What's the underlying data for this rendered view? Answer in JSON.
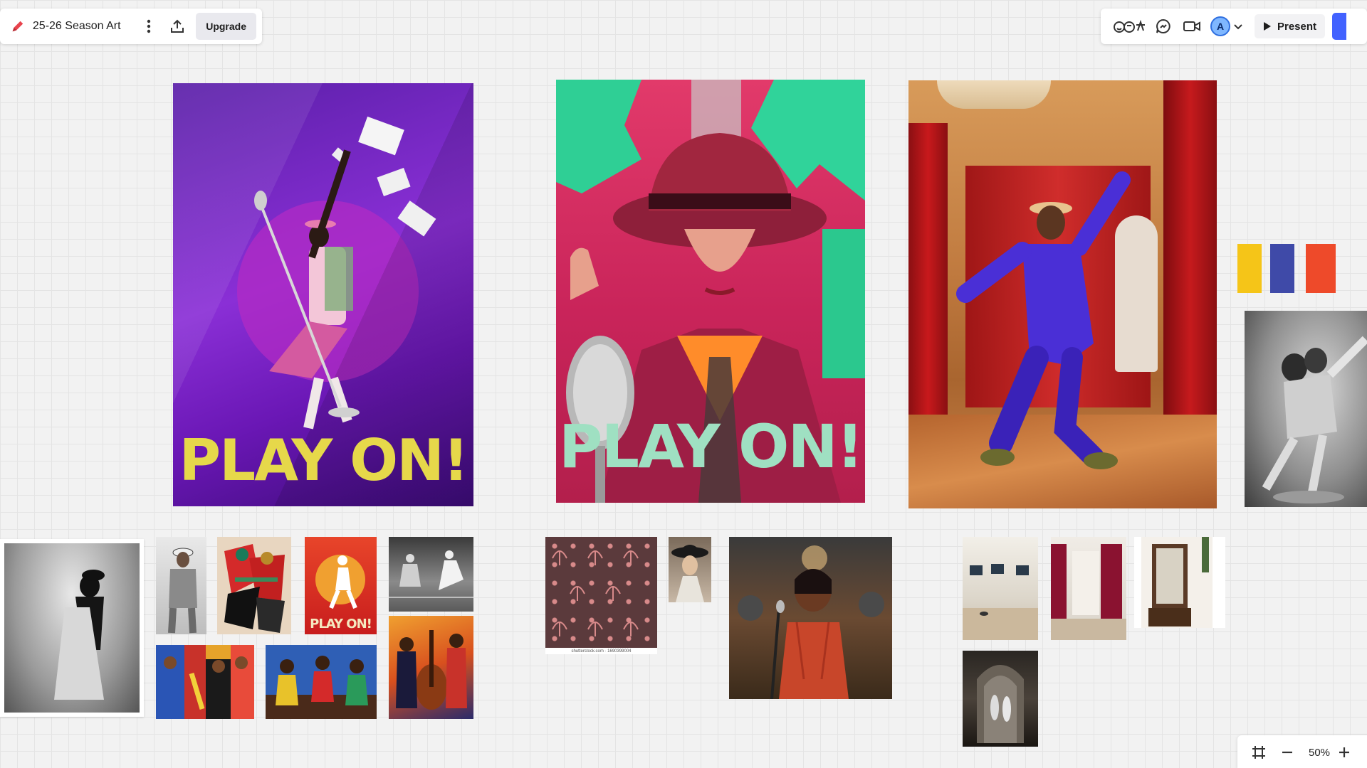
{
  "toolbar": {
    "board_title": "25-26 Season Art",
    "upgrade_label": "Upgrade",
    "present_label": "Present",
    "avatar_initial": "A",
    "zoom_level": "50%"
  },
  "posters": [
    {
      "title": "PLAY ON!",
      "theme": "purple dancer with microphone",
      "text_color": "#e6d84a"
    },
    {
      "title": "PLAY ON!",
      "theme": "woman in red fedora with microphone",
      "text_color": "#9fe0c2"
    },
    {
      "title": "",
      "theme": "dancer in blue suit before red curtains"
    }
  ],
  "swatches": [
    {
      "color": "#f5c518"
    },
    {
      "color": "#3f4aa8"
    },
    {
      "color": "#ee4a2a"
    }
  ],
  "thumbnails": {
    "small_poster_title": "PLAY ON!",
    "pattern_caption": "shutterstock.com · 1690399004"
  },
  "colors": {
    "accent": "#4262ff",
    "pen": "#e8444d"
  }
}
